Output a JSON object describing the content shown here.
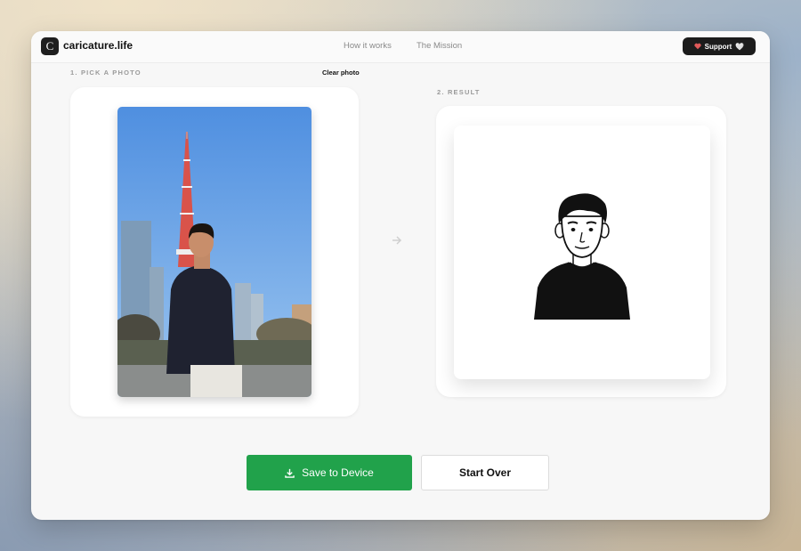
{
  "header": {
    "logo_letter": "C",
    "app_name": "caricature.life",
    "nav": [
      "How it works",
      "The Mission"
    ],
    "support_label": "Support",
    "support_emoji": "🤍"
  },
  "left": {
    "section_label": "1. PICK A PHOTO",
    "clear_label": "Clear photo"
  },
  "right": {
    "section_label": "2. RESULT"
  },
  "actions": {
    "save_label": "Save to Device",
    "start_over_label": "Start Over"
  },
  "colors": {
    "accent_green": "#21a24b",
    "support_bg": "#1c1c1c",
    "heart": "#e05a5a"
  },
  "icons": [
    "heart-icon",
    "arrow-right-icon",
    "download-icon"
  ]
}
